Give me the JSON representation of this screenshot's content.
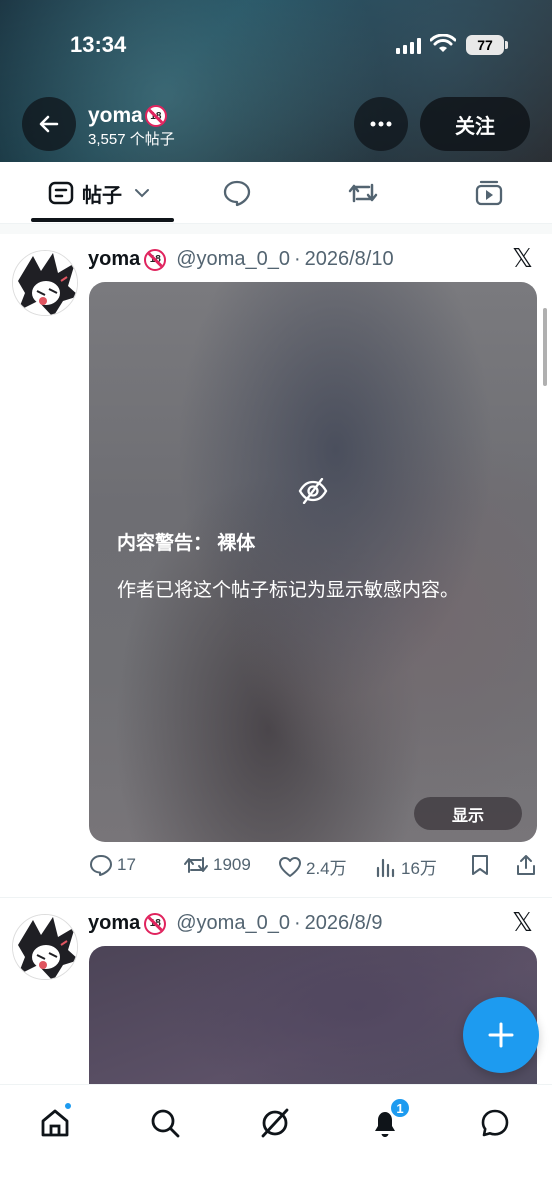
{
  "status_bar": {
    "time": "13:34",
    "battery": "77"
  },
  "profile": {
    "name": "yoma",
    "post_count": "3,557 个帖子",
    "follow_label": "关注"
  },
  "tabs": {
    "posts_label": "帖子"
  },
  "posts": [
    {
      "name": "yoma",
      "handle": "@yoma_0_0",
      "date": "2026/8/10",
      "warning_title": "内容警告： 裸体",
      "warning_text": "作者已将这个帖子标记为显示敏感内容。",
      "show_label": "显示",
      "replies": "17",
      "reposts": "1909",
      "likes": "2.4万",
      "views": "16万"
    },
    {
      "name": "yoma",
      "handle": "@yoma_0_0",
      "date": "2026/8/9"
    }
  ],
  "bottom_nav": {
    "notification_count": "1"
  },
  "colors": {
    "accent": "#1d9bf0",
    "text": "#0f1419",
    "muted": "#536471"
  }
}
